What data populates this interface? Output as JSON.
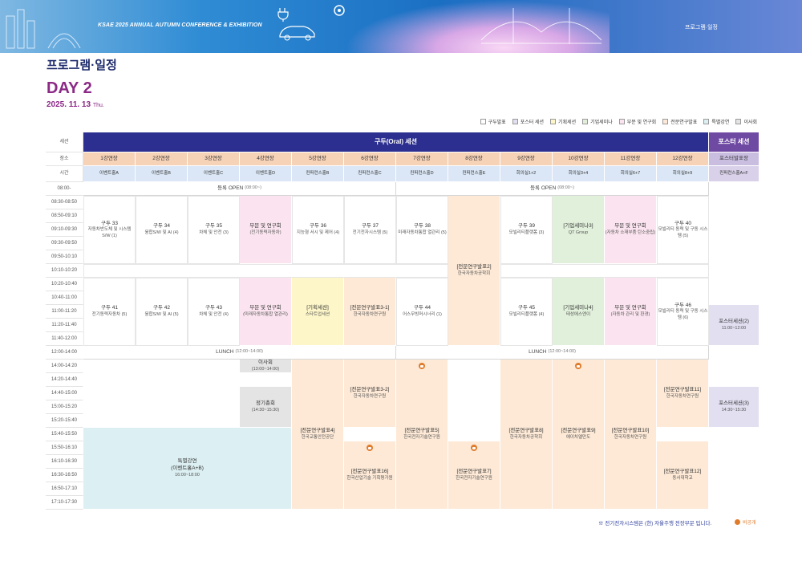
{
  "banner": {
    "title": "KSAE 2025 ANNUAL AUTUMN CONFERENCE & EXHIBITION",
    "crumb": "프로그램·일정"
  },
  "page": {
    "title": "프로그램·일정",
    "day": "DAY 2",
    "date": "2025. 11. 13",
    "dow": "Thu."
  },
  "legend": [
    {
      "label": "구두발표",
      "color": "#ffffff"
    },
    {
      "label": "포스터 세션",
      "color": "#e2dff1"
    },
    {
      "label": "기획세션",
      "color": "#fdf6c8"
    },
    {
      "label": "기업세미나",
      "color": "#e1f0db"
    },
    {
      "label": "부문 및 연구회",
      "color": "#fbe4ef"
    },
    {
      "label": "전문연구발표",
      "color": "#fde9d6"
    },
    {
      "label": "특별강연",
      "color": "#dceff2"
    },
    {
      "label": "이사회",
      "color": "#e4e4e4"
    }
  ],
  "header": {
    "session_label": "세션",
    "place_label": "장소",
    "time_label": "시간",
    "oral_title": "구두(Oral) 세션",
    "poster_title": "포스터 세션",
    "rooms": [
      "1강연장",
      "2강연장",
      "3강연장",
      "4강연장",
      "5강연장",
      "6강연장",
      "7강연장",
      "8강연장",
      "9강연장",
      "10강연장",
      "11강연장",
      "12강연장"
    ],
    "poster_room": "포스터발표장",
    "venues": [
      "이벤트홀A",
      "이벤트홀B",
      "이벤트홀C",
      "이벤트홀D",
      "컨퍼런스홀B",
      "컨퍼런스홀C",
      "컨퍼런스홀D",
      "컨퍼런스홀E",
      "회의실1+2",
      "회의실3+4",
      "회의실6+7",
      "회의실8+9"
    ],
    "poster_venue": "컨퍼런스홀A+F"
  },
  "times": [
    "08:00-",
    "08:30-08:50",
    "08:50-09:10",
    "09:10-09:30",
    "09:30-09:50",
    "09:50-10:10",
    "10:10-10:20",
    "10:20-10:40",
    "10:40-11:00",
    "11:00-11:20",
    "11:20-11:40",
    "11:40-12:00",
    "12:00-14:00",
    "14:00-14:20",
    "14:20-14:40",
    "14:40-15:00",
    "15:00-15:20",
    "15:20-15:40",
    "15:40-15:50",
    "15:50-16:10",
    "16:10-16:30",
    "16:30-16:50",
    "16:50-17:10",
    "17:10-17:30"
  ],
  "bands": {
    "registration": "등록 OPEN",
    "registration_time": "(08:00~)",
    "lunch": "LUNCH",
    "lunch_time": "(12:00~14:00)"
  },
  "sessions": {
    "s33": {
      "t": "구두 33",
      "s": "자동차반도체 및 시스템 S/W (1)"
    },
    "s34": {
      "t": "구두 34",
      "s": "융합S/W 및 AI (4)"
    },
    "s35": {
      "t": "구두 35",
      "s": "차체 및 안전 (3)"
    },
    "p4a": {
      "t": "부문 및 연구회",
      "s": "(전기동력자동차)"
    },
    "s36": {
      "t": "구두 36",
      "s": "지능형 서시 및 제어 (4)"
    },
    "s37": {
      "t": "구두 37",
      "s": "전기전자시스템 (5)"
    },
    "s38": {
      "t": "구두 38",
      "s": "미래자동차통합 열관리 (5)"
    },
    "e2": {
      "t": "[전문연구발표2]",
      "s": "한국자동차공학회"
    },
    "s39": {
      "t": "구두 39",
      "s": "모빌리티플랫폼 (3)"
    },
    "k3": {
      "t": "[기업세미나3]",
      "s": "QT Group"
    },
    "p11a": {
      "t": "부문 및 연구회",
      "s": "(자동차 소재부품 탄소중립)"
    },
    "s40": {
      "t": "구두 40",
      "s": "모빌리티 동력 및 구동 시스템 (5)"
    },
    "s41": {
      "t": "구두 41",
      "s": "전기동력자동차 (5)"
    },
    "s42": {
      "t": "구두 42",
      "s": "융합S/W 및 AI (5)"
    },
    "s43": {
      "t": "구두 43",
      "s": "차체 및 안전 (4)"
    },
    "p4b": {
      "t": "부문 및 연구회",
      "s": "(미래자동차통합 열관리)"
    },
    "g1": {
      "t": "[기획세션]",
      "s": "스타트업세션"
    },
    "e31": {
      "t": "[전문연구발표3-1]",
      "s": "한국자동차연구원"
    },
    "s44": {
      "t": "구두 44",
      "s": "어스무빙머시너리 (1)"
    },
    "s45": {
      "t": "구두 45",
      "s": "모빌리티플랫폼 (4)"
    },
    "k4": {
      "t": "[기업세미나4]",
      "s": "태성에스엔이"
    },
    "p11b": {
      "t": "부문 및 연구회",
      "s": "(자동차 관리 및 환경)"
    },
    "s46": {
      "t": "구두 46",
      "s": "모빌리티 동력 및 구동 시스템 (6)"
    },
    "ps2": {
      "t": "포스터세션(2)",
      "s": "11:00~12:00"
    },
    "board": {
      "t": "이사회",
      "s": "(13:00~14:00)"
    },
    "gm": {
      "t": "정기총회",
      "s": "(14:30~15:30)"
    },
    "e4": {
      "t": "[전문연구발표4]",
      "s": "한국교통안전공단"
    },
    "e32": {
      "t": "[전문연구발표3-2]",
      "s": "한국자동차연구원"
    },
    "e16": {
      "t": "[전문연구발표16]",
      "s": "한국산업기술 기획평가원"
    },
    "e5": {
      "t": "[전문연구발표5]",
      "s": "한국전자기술연구원"
    },
    "e7": {
      "t": "[전문연구발표7]",
      "s": "한국전자기술연구원"
    },
    "e8": {
      "t": "[전문연구발표8]",
      "s": "한국자동차공학회"
    },
    "e9": {
      "t": "[전문연구발표9]",
      "s": "에이치엘만도"
    },
    "e10": {
      "t": "[전문연구발표10]",
      "s": "한국자동차연구원"
    },
    "e11": {
      "t": "[전문연구발표11]",
      "s": "한국자동차연구원"
    },
    "e12": {
      "t": "[전문연구발표12]",
      "s": "동서대학교"
    },
    "ps3": {
      "t": "포스터세션(3)",
      "s": "14:30~15:30"
    },
    "sp": {
      "t": "특별강연",
      "s": "(이벤트홀A+B)",
      "s2": "16:00~18:00"
    }
  },
  "footer": {
    "note": "※ 전기전자시스템은 (현) 자율주행 전장부문 입니다.",
    "private_label": "비공개"
  }
}
